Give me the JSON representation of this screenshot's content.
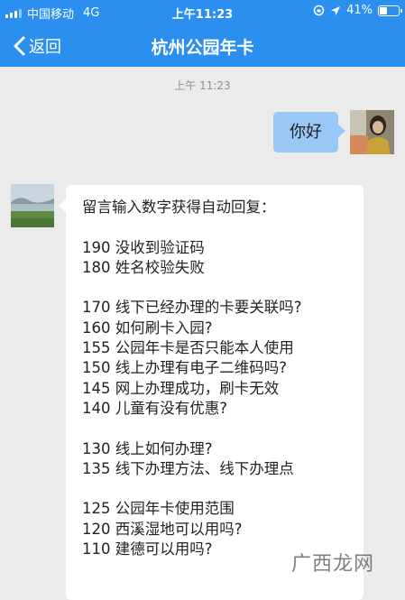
{
  "status_bar": {
    "carrier": "中国移动",
    "network": "4G",
    "time": "上午11:23",
    "battery": "41%"
  },
  "nav": {
    "back_label": "返回",
    "title": "杭州公园年卡"
  },
  "chat": {
    "timestamp": "上午 11:23",
    "outgoing": {
      "text": "你好"
    },
    "incoming": {
      "intro": "留言输入数字获得自动回复：",
      "groups": [
        [
          "190 没收到验证码",
          "180 姓名校验失败"
        ],
        [
          "170 线下已经办理的卡要关联吗?",
          "160 如何刷卡入园?",
          "155 公园年卡是否只能本人使用",
          "150 线上办理有电子二维码吗?",
          "145 网上办理成功，刷卡无效",
          "140 儿童有没有优惠?"
        ],
        [
          "130 线上如何办理?",
          "135 线下办理方法、线下办理点"
        ],
        [
          "125 公园年卡使用范围",
          "120 西溪湿地可以用吗?",
          "110 建德可以用吗?"
        ]
      ]
    }
  },
  "watermark": "广西龙网",
  "colors": {
    "header": "#2b8ff0",
    "outgoing_bubble": "#99c8f7",
    "background": "#ebebeb"
  }
}
